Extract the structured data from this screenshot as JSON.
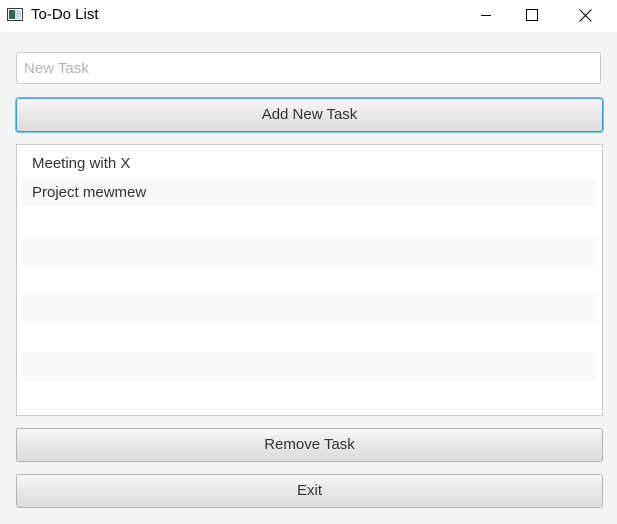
{
  "window": {
    "title": "To-Do List",
    "icon": "java-app-icon",
    "controls": [
      "minimize-icon",
      "maximize-icon",
      "close-icon"
    ]
  },
  "new_task_input": {
    "value": "",
    "placeholder": "New Task"
  },
  "buttons": {
    "add": "Add New Task",
    "remove": "Remove Task",
    "exit": "Exit"
  },
  "task_list": {
    "items": [
      "Meeting with X",
      "Project mewmew"
    ]
  },
  "colors": {
    "focus_border": "#3b9bdc",
    "list_alt_row": "#f9f9f9",
    "placeholder": "#b3b3b3"
  }
}
